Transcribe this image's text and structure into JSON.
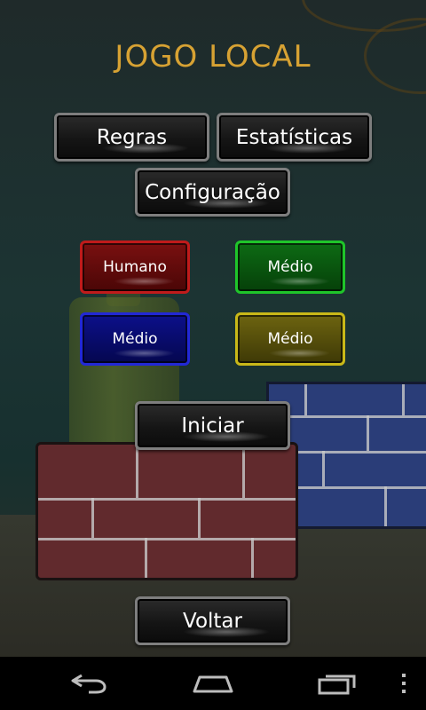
{
  "title": "JOGO LOCAL",
  "buttons": {
    "rules": "Regras",
    "statistics": "Estatísticas",
    "settings": "Configuração",
    "start": "Iniciar",
    "back": "Voltar"
  },
  "players": [
    {
      "label": "Humano",
      "color": "#c01b1b"
    },
    {
      "label": "Médio",
      "color": "#1fc52a"
    },
    {
      "label": "Médio",
      "color": "#2228d6"
    },
    {
      "label": "Médio",
      "color": "#c9b818"
    }
  ],
  "nav": {
    "back_icon": "back-arrow-icon",
    "home_icon": "home-icon",
    "recents_icon": "recent-apps-icon",
    "menu_icon": "overflow-menu-icon"
  },
  "colors": {
    "title": "#d7a233",
    "button_border": "#7e7e7e"
  }
}
